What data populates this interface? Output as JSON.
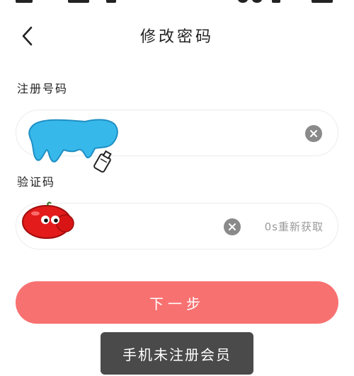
{
  "header": {
    "title": "修改密码",
    "back_icon": "chevron-left-icon"
  },
  "phone_field": {
    "label": "注册号码",
    "value": "",
    "clear_icon": "close-circle-icon"
  },
  "code_field": {
    "label": "验证码",
    "value": "",
    "clear_icon": "close-circle-icon",
    "resend_label": "0s重新获取"
  },
  "next_button": {
    "label": "下一步",
    "color": "#f87171"
  },
  "toast": {
    "message": "手机未注册会员"
  },
  "decorations": {
    "cow_sticker_icon": "cow-sticker-icon",
    "tomato_sticker_icon": "tomato-sticker-icon"
  }
}
